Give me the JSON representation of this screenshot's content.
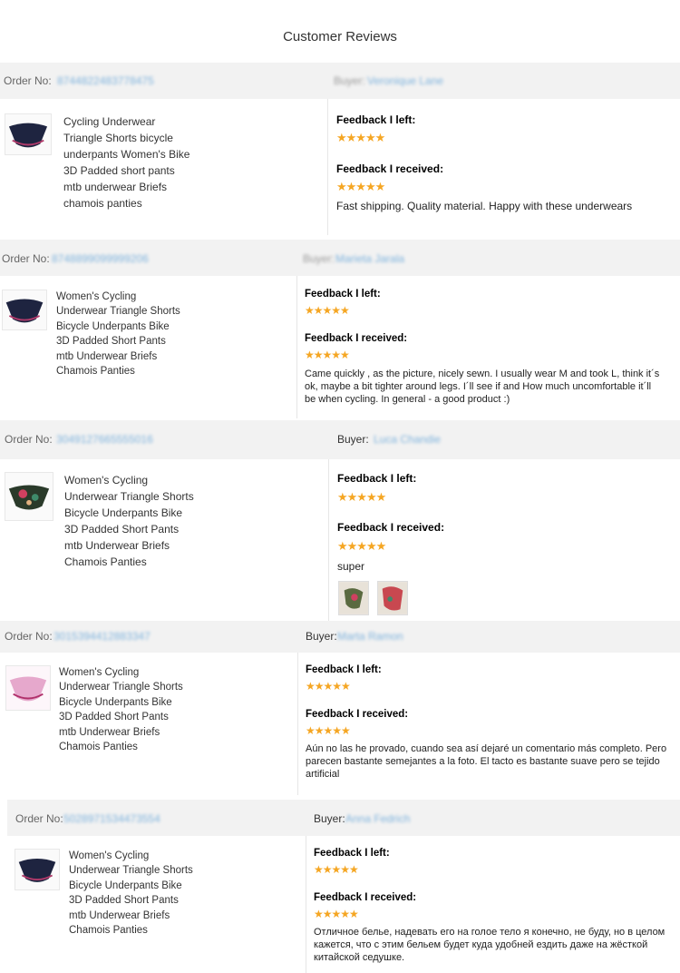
{
  "page_title": "Customer Reviews",
  "stars": "★★★★★",
  "feedback_left_label": "Feedback I left:",
  "feedback_received_label": "Feedback I received:",
  "order_label_1": "Order No:",
  "order_label_2": "Order No:",
  "buyer_label": "Buyer:",
  "reviews": [
    {
      "order_no": "8744822483778475",
      "buyer_label_blurred": "Buyer:",
      "buyer_name": "Veronique Lane",
      "product_lines": [
        "Cycling Underwear",
        "Triangle Shorts bicycle",
        "underpants Women's Bike",
        "3D Padded short pants",
        "mtb underwear Briefs",
        "chamois panties"
      ],
      "comment_lines": [
        "Fast shipping. Quality material. Happy with these underwears"
      ],
      "thumb_color": "#1e2440",
      "accent_color": "#b03a6a"
    },
    {
      "order_no": "8748899099999206",
      "buyer_label_blurred": "Buyer:",
      "buyer_name": "Marieta Jarala",
      "product_lines": [
        "Women's Cycling",
        "Underwear Triangle Shorts",
        "Bicycle Underpants Bike",
        "3D Padded Short Pants",
        "mtb Underwear Briefs",
        "Chamois Panties"
      ],
      "comment_lines": [
        "Came quickly , as the picture, nicely sewn. I usually wear M and took L, think it´s",
        "ok, maybe a bit tighter around legs. I´ll see if and How much uncomfortable it´ll",
        "be when cycling. In general - a good product :)"
      ],
      "thumb_color": "#1e2440",
      "accent_color": "#b03a6a"
    },
    {
      "order_no": "3049127665555016",
      "buyer_name": "Luca Chandie",
      "product_lines": [
        "Women's Cycling",
        "Underwear Triangle Shorts",
        "Bicycle Underpants Bike",
        "3D Padded Short Pants",
        "mtb Underwear Briefs",
        "Chamois Panties"
      ],
      "comment_lines": [
        "super"
      ],
      "thumb_color": "#2a3a2a",
      "accent_color": "#d04060"
    },
    {
      "order_no": "3015394412883347",
      "buyer_name": "Marta Ramon",
      "product_lines": [
        "Women's Cycling",
        "Underwear Triangle Shorts",
        "Bicycle Underpants Bike",
        "3D Padded Short Pants",
        "mtb Underwear Briefs",
        "Chamois Panties"
      ],
      "comment_lines": [
        "Aún no las he provado, cuando sea así dejaré un comentario más completo. Pero",
        "parecen bastante semejantes a la foto. El tacto es bastante suave pero se tejido",
        "artificial"
      ],
      "thumb_color": "#e6a8cc",
      "accent_color": "#b0306a"
    },
    {
      "order_no": "5028971534473554",
      "buyer_name": "Anna Fedrich",
      "product_lines": [
        "Women's Cycling",
        "Underwear Triangle Shorts",
        "Bicycle Underpants Bike",
        "3D Padded Short Pants",
        "mtb Underwear Briefs",
        "Chamois Panties"
      ],
      "comment_lines": [
        "Отличное белье, надевать его на голое тело я конечно, не буду, но в целом",
        "кажется, что с этим бельем будет куда удобней ездить даже на жёсткой",
        "китайской седушке."
      ],
      "thumb_color": "#1e2440",
      "accent_color": "#b03a6a"
    }
  ]
}
